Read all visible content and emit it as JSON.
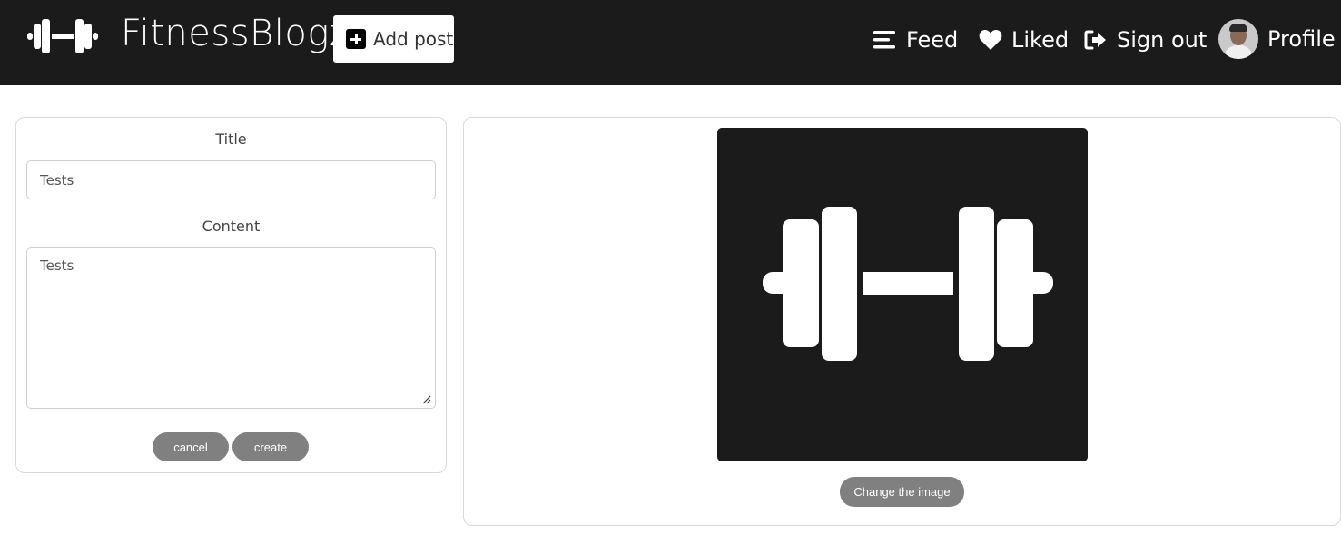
{
  "header": {
    "brand_title": "FitnessBlogz",
    "add_post_label": "Add post",
    "nav": {
      "feed": "Feed",
      "liked": "Liked",
      "sign_out": "Sign out",
      "profile": "Profile"
    }
  },
  "form": {
    "title_label": "Title",
    "title_value": "Tests",
    "content_label": "Content",
    "content_value": "Tests",
    "cancel_label": "cancel",
    "create_label": "create"
  },
  "image_panel": {
    "change_image_label": "Change the image"
  },
  "colors": {
    "navbar_bg": "#1b1b1b",
    "button_gray": "#808080"
  }
}
